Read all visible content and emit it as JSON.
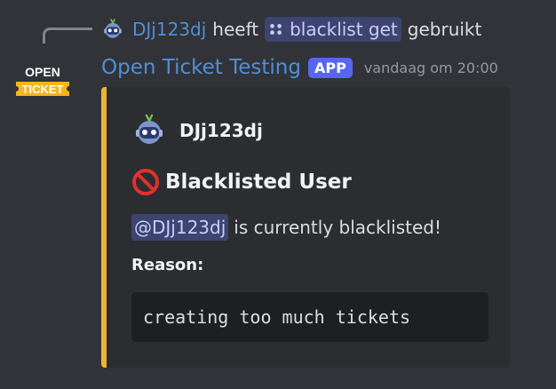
{
  "reply": {
    "username": "DJj123dj",
    "used_text": "heeft",
    "command": "blacklist get",
    "suffix": "gebruikt"
  },
  "message": {
    "bot_name": "Open Ticket Testing",
    "badge": "APP",
    "timestamp": "vandaag om 20:00",
    "bot_avatar_text": {
      "top": "OPEN",
      "bottom": "TICKET"
    }
  },
  "embed": {
    "accent_color": "#f0b232",
    "author": "DJj123dj",
    "title": "Blacklisted User",
    "mention": "@DJj123dj",
    "description": "is currently blacklisted!",
    "field_name": "Reason:",
    "field_value": "creating too much tickets"
  },
  "colors": {
    "background": "#313338",
    "embed_background": "#2b2d31",
    "username": "#4f8fd8",
    "badge": "#5865f2",
    "mention_bg": "#3e4470"
  },
  "icons": {
    "reply_avatar": "discord-robot-avatar-icon",
    "command": "slash-command-icon",
    "bot_avatar": "open-ticket-logo",
    "author_avatar": "discord-robot-avatar-icon",
    "title_icon": "no-entry-icon"
  }
}
